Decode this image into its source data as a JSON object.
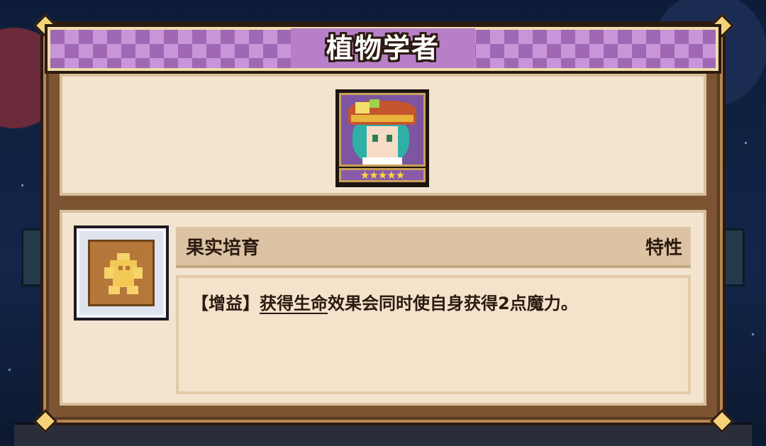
{
  "dialog": {
    "title": "植物学者",
    "portrait": {
      "icon": "botanist-character-portrait",
      "stars": "★★★★★",
      "star_count": 5
    }
  },
  "trait": {
    "icon": "fruit-cultivation-trait-icon",
    "name": "果实培育",
    "type": "特性",
    "description": {
      "prefix": "【增益】",
      "keyword": "获得生命",
      "rest": "效果会同时使自身获得2点魔力。"
    }
  },
  "colors": {
    "banner_purple": "#a068b4",
    "panel_cream": "#f3e4cf",
    "frame_brown": "#7d5432",
    "text_dark": "#2b1a10"
  }
}
